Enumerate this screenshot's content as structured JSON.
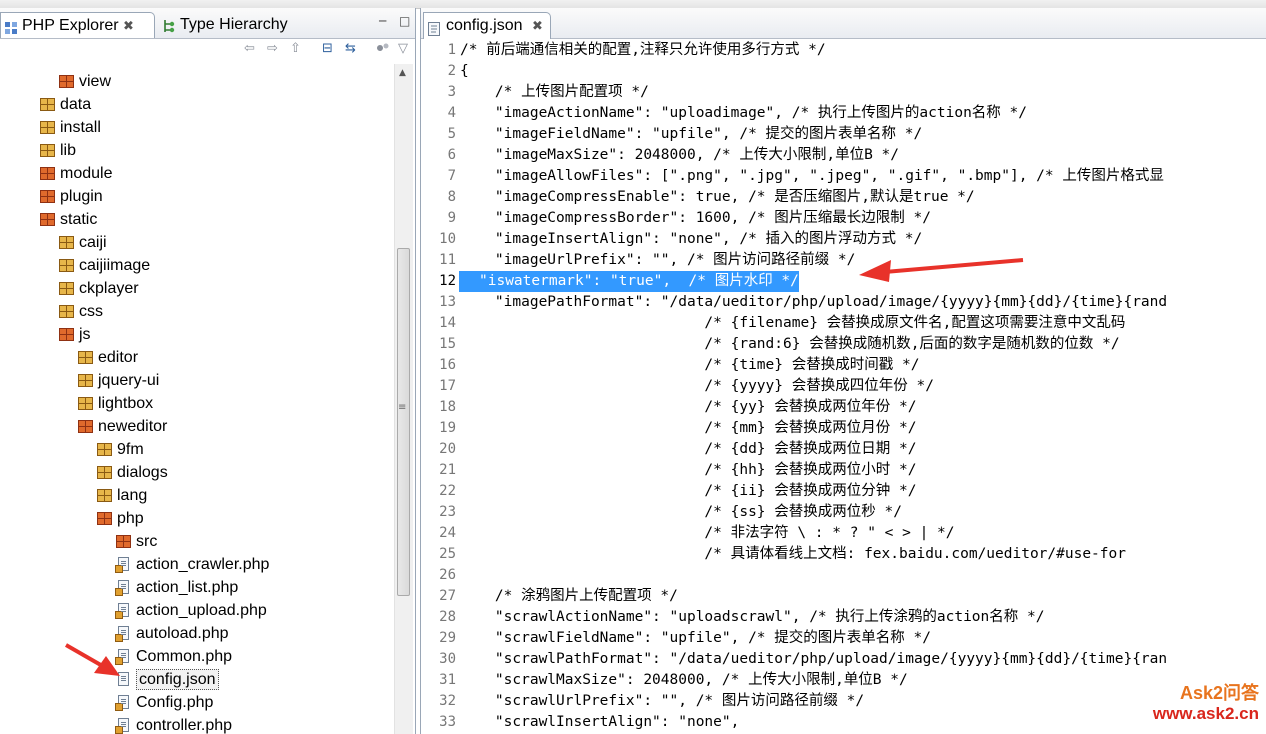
{
  "left_panel": {
    "tabs": [
      {
        "label": "PHP Explorer",
        "active": true,
        "close": "✖"
      },
      {
        "label": "Type Hierarchy",
        "active": false
      }
    ],
    "window_buttons": {
      "minimize": "─",
      "maximize": "□"
    },
    "toolbar": {
      "back": "⇦",
      "forward": "⇨",
      "up": "⇧",
      "collapse_all": "⊟",
      "link_editor": "⇆",
      "view_menu_icon": "▽"
    },
    "tree": [
      {
        "label": "view",
        "depth": 1,
        "kind": "pkg-red"
      },
      {
        "label": "data",
        "depth": 0,
        "kind": "pkg"
      },
      {
        "label": "install",
        "depth": 0,
        "kind": "pkg"
      },
      {
        "label": "lib",
        "depth": 0,
        "kind": "pkg"
      },
      {
        "label": "module",
        "depth": 0,
        "kind": "pkg-red"
      },
      {
        "label": "plugin",
        "depth": 0,
        "kind": "pkg-red"
      },
      {
        "label": "static",
        "depth": 0,
        "kind": "pkg-red"
      },
      {
        "label": "caiji",
        "depth": 1,
        "kind": "pkg"
      },
      {
        "label": "caijiimage",
        "depth": 1,
        "kind": "pkg"
      },
      {
        "label": "ckplayer",
        "depth": 1,
        "kind": "pkg"
      },
      {
        "label": "css",
        "depth": 1,
        "kind": "pkg"
      },
      {
        "label": "js",
        "depth": 1,
        "kind": "pkg-red"
      },
      {
        "label": "editor",
        "depth": 2,
        "kind": "pkg"
      },
      {
        "label": "jquery-ui",
        "depth": 2,
        "kind": "pkg"
      },
      {
        "label": "lightbox",
        "depth": 2,
        "kind": "pkg"
      },
      {
        "label": "neweditor",
        "depth": 2,
        "kind": "pkg-red"
      },
      {
        "label": "9fm",
        "depth": 3,
        "kind": "pkg"
      },
      {
        "label": "dialogs",
        "depth": 3,
        "kind": "pkg"
      },
      {
        "label": "lang",
        "depth": 3,
        "kind": "pkg"
      },
      {
        "label": "php",
        "depth": 3,
        "kind": "pkg-red"
      },
      {
        "label": "src",
        "depth": 4,
        "kind": "pkg-red"
      },
      {
        "label": "action_crawler.php",
        "depth": 4,
        "kind": "php"
      },
      {
        "label": "action_list.php",
        "depth": 4,
        "kind": "php"
      },
      {
        "label": "action_upload.php",
        "depth": 4,
        "kind": "php"
      },
      {
        "label": "autoload.php",
        "depth": 4,
        "kind": "php"
      },
      {
        "label": "Common.php",
        "depth": 4,
        "kind": "php"
      },
      {
        "label": "config.json",
        "depth": 4,
        "kind": "file",
        "selected": true
      },
      {
        "label": "Config.php",
        "depth": 4,
        "kind": "php"
      },
      {
        "label": "controller.php",
        "depth": 4,
        "kind": "php"
      }
    ]
  },
  "editor": {
    "tab": {
      "label": "config.json",
      "close": "✖"
    },
    "lines": [
      {
        "n": "1",
        "text": "/* 前后端通信相关的配置,注释只允许使用多行方式 */"
      },
      {
        "n": "2",
        "text": "{"
      },
      {
        "n": "3",
        "text": "    /* 上传图片配置项 */"
      },
      {
        "n": "4",
        "text": "    \"imageActionName\": \"uploadimage\", /* 执行上传图片的action名称 */"
      },
      {
        "n": "5",
        "text": "    \"imageFieldName\": \"upfile\", /* 提交的图片表单名称 */"
      },
      {
        "n": "6",
        "text": "    \"imageMaxSize\": 2048000, /* 上传大小限制,单位B */"
      },
      {
        "n": "7",
        "text": "    \"imageAllowFiles\": [\".png\", \".jpg\", \".jpeg\", \".gif\", \".bmp\"], /* 上传图片格式显"
      },
      {
        "n": "8",
        "text": "    \"imageCompressEnable\": true, /* 是否压缩图片,默认是true */"
      },
      {
        "n": "9",
        "text": "    \"imageCompressBorder\": 1600, /* 图片压缩最长边限制 */"
      },
      {
        "n": "10",
        "text": "    \"imageInsertAlign\": \"none\", /* 插入的图片浮动方式 */"
      },
      {
        "n": "11",
        "text": "    \"imageUrlPrefix\": \"\", /* 图片访问路径前缀 */"
      },
      {
        "n": "12",
        "text": "\"iswatermark\": \"true\",  /* 图片水印 */",
        "highlight": true
      },
      {
        "n": "13",
        "text": "    \"imagePathFormat\": \"/data/ueditor/php/upload/image/{yyyy}{mm}{dd}/{time}{rand"
      },
      {
        "n": "14",
        "text": "                            /* {filename} 会替换成原文件名,配置这项需要注意中文乱码"
      },
      {
        "n": "15",
        "text": "                            /* {rand:6} 会替换成随机数,后面的数字是随机数的位数 */"
      },
      {
        "n": "16",
        "text": "                            /* {time} 会替换成时间戳 */"
      },
      {
        "n": "17",
        "text": "                            /* {yyyy} 会替换成四位年份 */"
      },
      {
        "n": "18",
        "text": "                            /* {yy} 会替换成两位年份 */"
      },
      {
        "n": "19",
        "text": "                            /* {mm} 会替换成两位月份 */"
      },
      {
        "n": "20",
        "text": "                            /* {dd} 会替换成两位日期 */"
      },
      {
        "n": "21",
        "text": "                            /* {hh} 会替换成两位小时 */"
      },
      {
        "n": "22",
        "text": "                            /* {ii} 会替换成两位分钟 */"
      },
      {
        "n": "23",
        "text": "                            /* {ss} 会替换成两位秒 */"
      },
      {
        "n": "24",
        "text": "                            /* 非法字符 \\ : * ? \" < > | */"
      },
      {
        "n": "25",
        "text": "                            /* 具请体看线上文档: fex.baidu.com/ueditor/#use-for"
      },
      {
        "n": "26",
        "text": ""
      },
      {
        "n": "27",
        "text": "    /* 涂鸦图片上传配置项 */"
      },
      {
        "n": "28",
        "text": "    \"scrawlActionName\": \"uploadscrawl\", /* 执行上传涂鸦的action名称 */"
      },
      {
        "n": "29",
        "text": "    \"scrawlFieldName\": \"upfile\", /* 提交的图片表单名称 */"
      },
      {
        "n": "30",
        "text": "    \"scrawlPathFormat\": \"/data/ueditor/php/upload/image/{yyyy}{mm}{dd}/{time}{ran"
      },
      {
        "n": "31",
        "text": "    \"scrawlMaxSize\": 2048000, /* 上传大小限制,单位B */"
      },
      {
        "n": "32",
        "text": "    \"scrawlUrlPrefix\": \"\", /* 图片访问路径前缀 */"
      },
      {
        "n": "33",
        "text": "    \"scrawlInsertAlign\": \"none\","
      }
    ]
  },
  "watermark": {
    "line1": "Ask2问答",
    "line2": "www.ask2.cn"
  },
  "colors": {
    "selection": "#3399ff",
    "arrow": "#e8322a",
    "watermark": "#e8741e"
  }
}
